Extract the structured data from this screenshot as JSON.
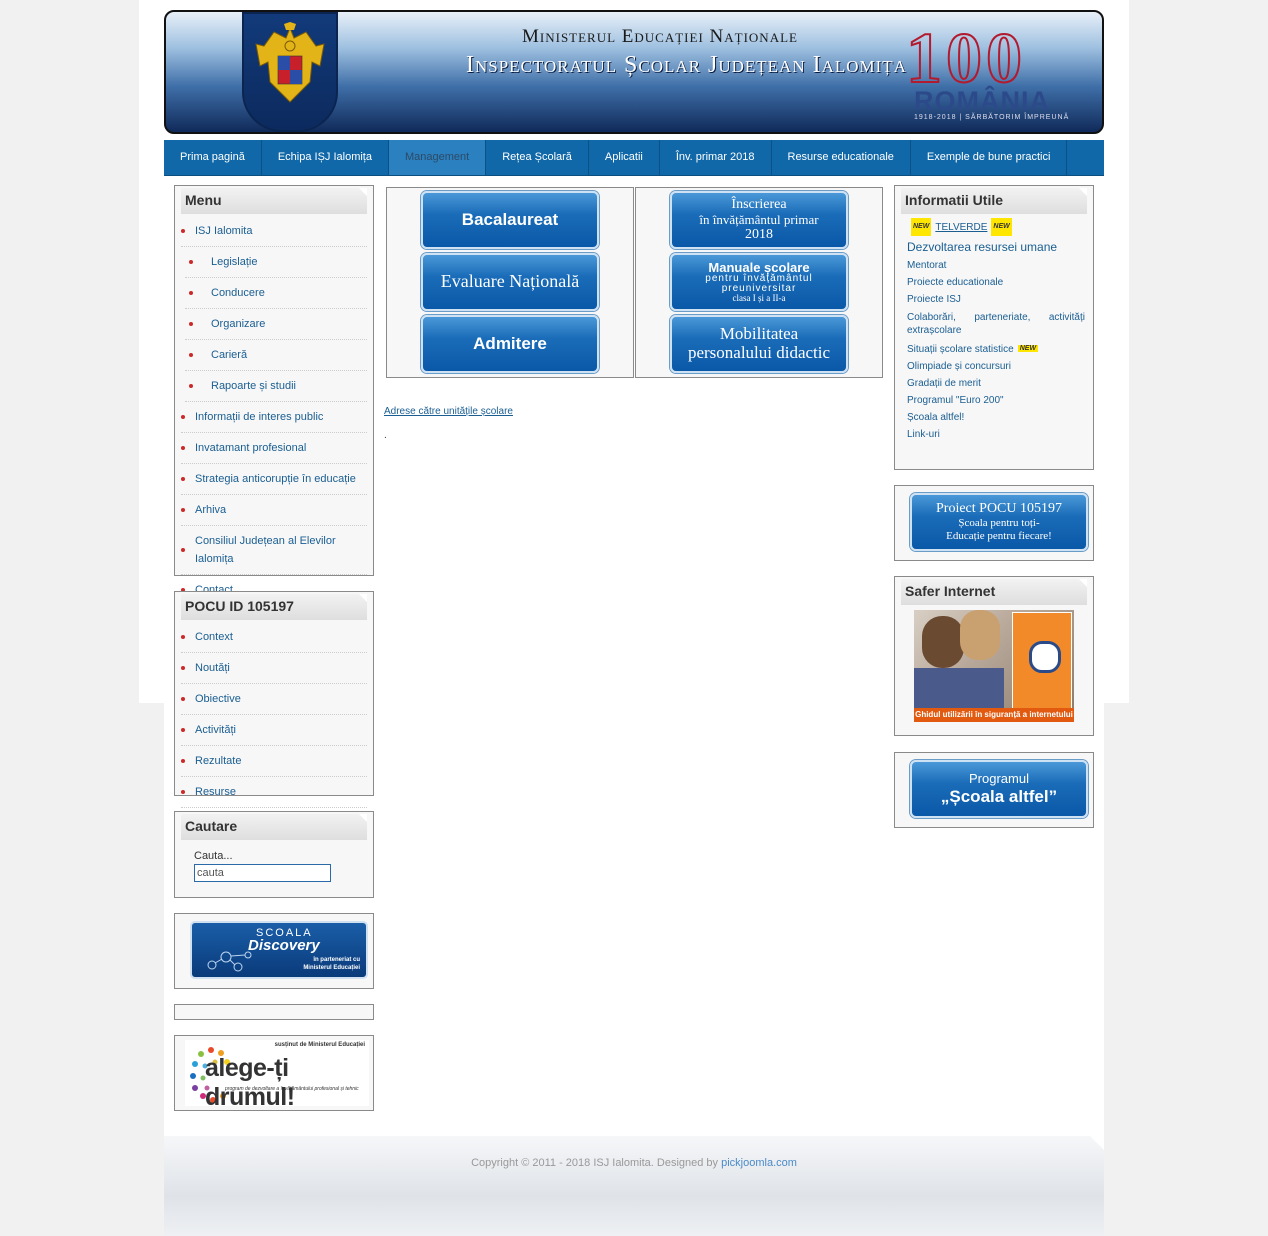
{
  "header": {
    "title_line1": "Ministerul Educației Naționale",
    "title_line2": "Inspectoratul Școlar Județean Ialomița",
    "centenary_number": "100",
    "centenary_country": "ROMÂNIA",
    "centenary_tagline": "1918-2018 | SĂRBĂTORIM ÎMPREUNĂ"
  },
  "nav": {
    "items": [
      {
        "label": "Prima pagină"
      },
      {
        "label": "Echipa IȘJ Ialomița"
      },
      {
        "label": "Management"
      },
      {
        "label": "Rețea Școlară"
      },
      {
        "label": "Aplicatii"
      },
      {
        "label": "Înv. primar 2018"
      },
      {
        "label": "Resurse educationale"
      },
      {
        "label": "Exemple de bune practici"
      }
    ]
  },
  "menu": {
    "title": "Menu",
    "items": [
      "ISJ Ialomita",
      "Legislație",
      "Conducere",
      "Organizare",
      "Carieră",
      "Rapoarte și studii",
      "Informații de interes public",
      "Invatamant profesional",
      "Strategia anticorupție în educație",
      "Arhiva",
      "Consiliul Județean al Elevilor Ialomița",
      "Contact"
    ]
  },
  "pocu_menu": {
    "title": "POCU ID 105197",
    "items": [
      "Context",
      "Noutăți",
      "Obiective",
      "Activități",
      "Rezultate",
      "Resurse"
    ]
  },
  "search": {
    "title": "Cautare",
    "label": "Cauta...",
    "value": "cauta"
  },
  "discovery": {
    "line1": "SCOALA",
    "line2": "Discovery",
    "line3": "în parteneriat cu",
    "line4": "Ministerul Educației"
  },
  "alege": {
    "top": "susținut de Ministerul Educației",
    "main": "alege-ți drumul!",
    "sub": "program de dezvoltare a învățământului profesional și tehnic"
  },
  "center_buttons": {
    "left": [
      "Bacalaureat",
      "Evaluare Națională",
      "Admitere"
    ],
    "right": [
      {
        "l1": "Înscrierea",
        "l2": "în învățământul primar",
        "l3": "2018"
      },
      {
        "l1": "Manuale școlare",
        "l2": "pentru învățământul",
        "l3": "preuniversitar",
        "l4": "clasa I și a II-a"
      },
      {
        "l1": "Mobilitatea",
        "l2": "personalului didactic"
      }
    ]
  },
  "center_links": {
    "adrese": "Adrese către unitățile școlare",
    "dot": "."
  },
  "info": {
    "title": "Informatii Utile",
    "new_label": "NEW",
    "telverde": "TELVERDE",
    "dezvoltarea": "Dezvoltarea resursei umane",
    "links": [
      "Mentorat",
      "Proiecte educationale",
      "Proiecte ISJ",
      "Colaborări, parteneriate, activități extrașcolare",
      "Situații școlare statistice",
      "Olimpiade și concursuri",
      "Gradații de merit",
      "Programul \"Euro 200\"",
      "Școala altfel!",
      "Link-uri"
    ]
  },
  "pocu_banner": {
    "l1": "Proiect POCU 105197",
    "l2": "Școala pentru toți-",
    "l3": "Educație pentru fiecare!"
  },
  "safer": {
    "title": "Safer Internet",
    "caption": "Ghidul utilizării în siguranță a internetului"
  },
  "scoala_altfel_banner": {
    "l1": "Programul",
    "l2": "„Școala altfel”"
  },
  "footer": {
    "copyright": "Copyright © 2011 - 2018 ISJ Ialomita. Designed by",
    "designer": "pickjoomla.com"
  },
  "colors": {
    "nav_bg": "#1068a8",
    "link": "#1a5e92",
    "bullet": "#cc2a2a",
    "button_blue": "#0a58a8"
  }
}
